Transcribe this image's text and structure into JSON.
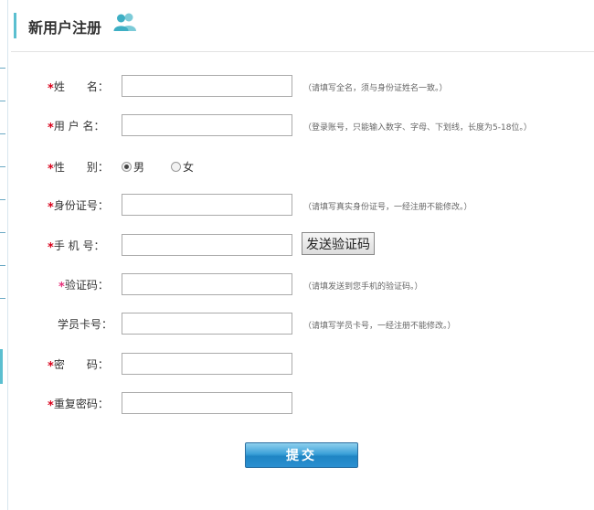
{
  "header": {
    "title": "新用户注册",
    "icon": "users-icon"
  },
  "required_mark": "*",
  "fields": {
    "name": {
      "label": "姓　　名：",
      "value": "",
      "hint": "（请填写全名，须与身份证姓名一致。）"
    },
    "username": {
      "label": "用 户 名：",
      "value": "",
      "hint": "（登录账号，只能输入数字、字母、下划线，长度为5-18位。）"
    },
    "gender": {
      "label": "性　　别：",
      "options": [
        "男",
        "女"
      ],
      "selected": "男"
    },
    "id_number": {
      "label": "身份证号：",
      "value": "",
      "hint": "（请填写真实身份证号，一经注册不能修改。）"
    },
    "phone": {
      "label": "手 机 号：",
      "value": "",
      "button": "发送验证码"
    },
    "code": {
      "label": "验证码：",
      "value": "",
      "hint": "（请填发送到您手机的验证码。）"
    },
    "student_card": {
      "label": "学员卡号：",
      "value": "",
      "hint": "（请填写学员卡号，一经注册不能修改。）"
    },
    "password": {
      "label": "密　　码：",
      "value": ""
    },
    "confirm_password": {
      "label": "重复密码：",
      "value": ""
    }
  },
  "submit_label": "提交",
  "colors": {
    "accent": "#5bbfd0",
    "required": "#d8001a",
    "button_blue": "#1f85c4"
  }
}
